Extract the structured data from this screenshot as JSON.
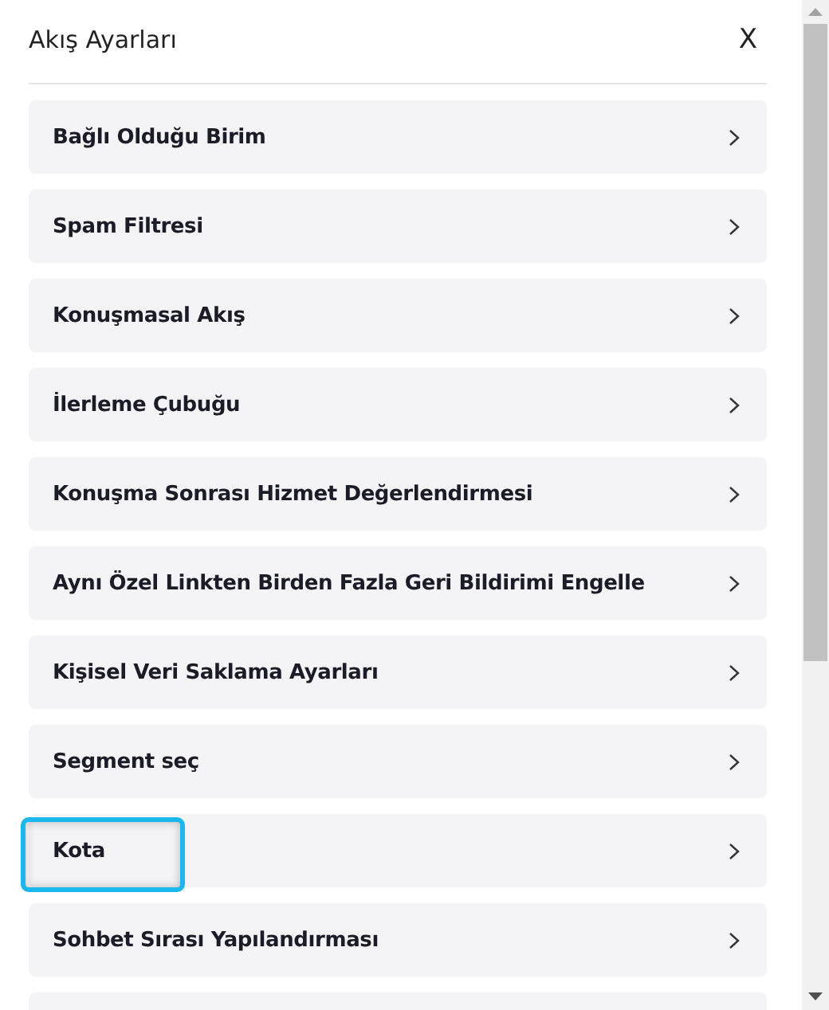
{
  "panel": {
    "title": "Akış Ayarları",
    "close": "X"
  },
  "items": [
    {
      "label": "Bağlı Olduğu Birim",
      "highlighted": false
    },
    {
      "label": "Spam Filtresi",
      "highlighted": false
    },
    {
      "label": "Konuşmasal Akış",
      "highlighted": false
    },
    {
      "label": "İlerleme Çubuğu",
      "highlighted": false
    },
    {
      "label": "Konuşma Sonrası Hizmet Değerlendirmesi",
      "highlighted": false
    },
    {
      "label": "Aynı Özel Linkten Birden Fazla Geri Bildirimi Engelle",
      "highlighted": false
    },
    {
      "label": "Kişisel Veri Saklama Ayarları",
      "highlighted": false
    },
    {
      "label": "Segment seç",
      "highlighted": false
    },
    {
      "label": "Kota",
      "highlighted": true
    },
    {
      "label": "Sohbet Sırası Yapılandırması",
      "highlighted": false
    }
  ]
}
